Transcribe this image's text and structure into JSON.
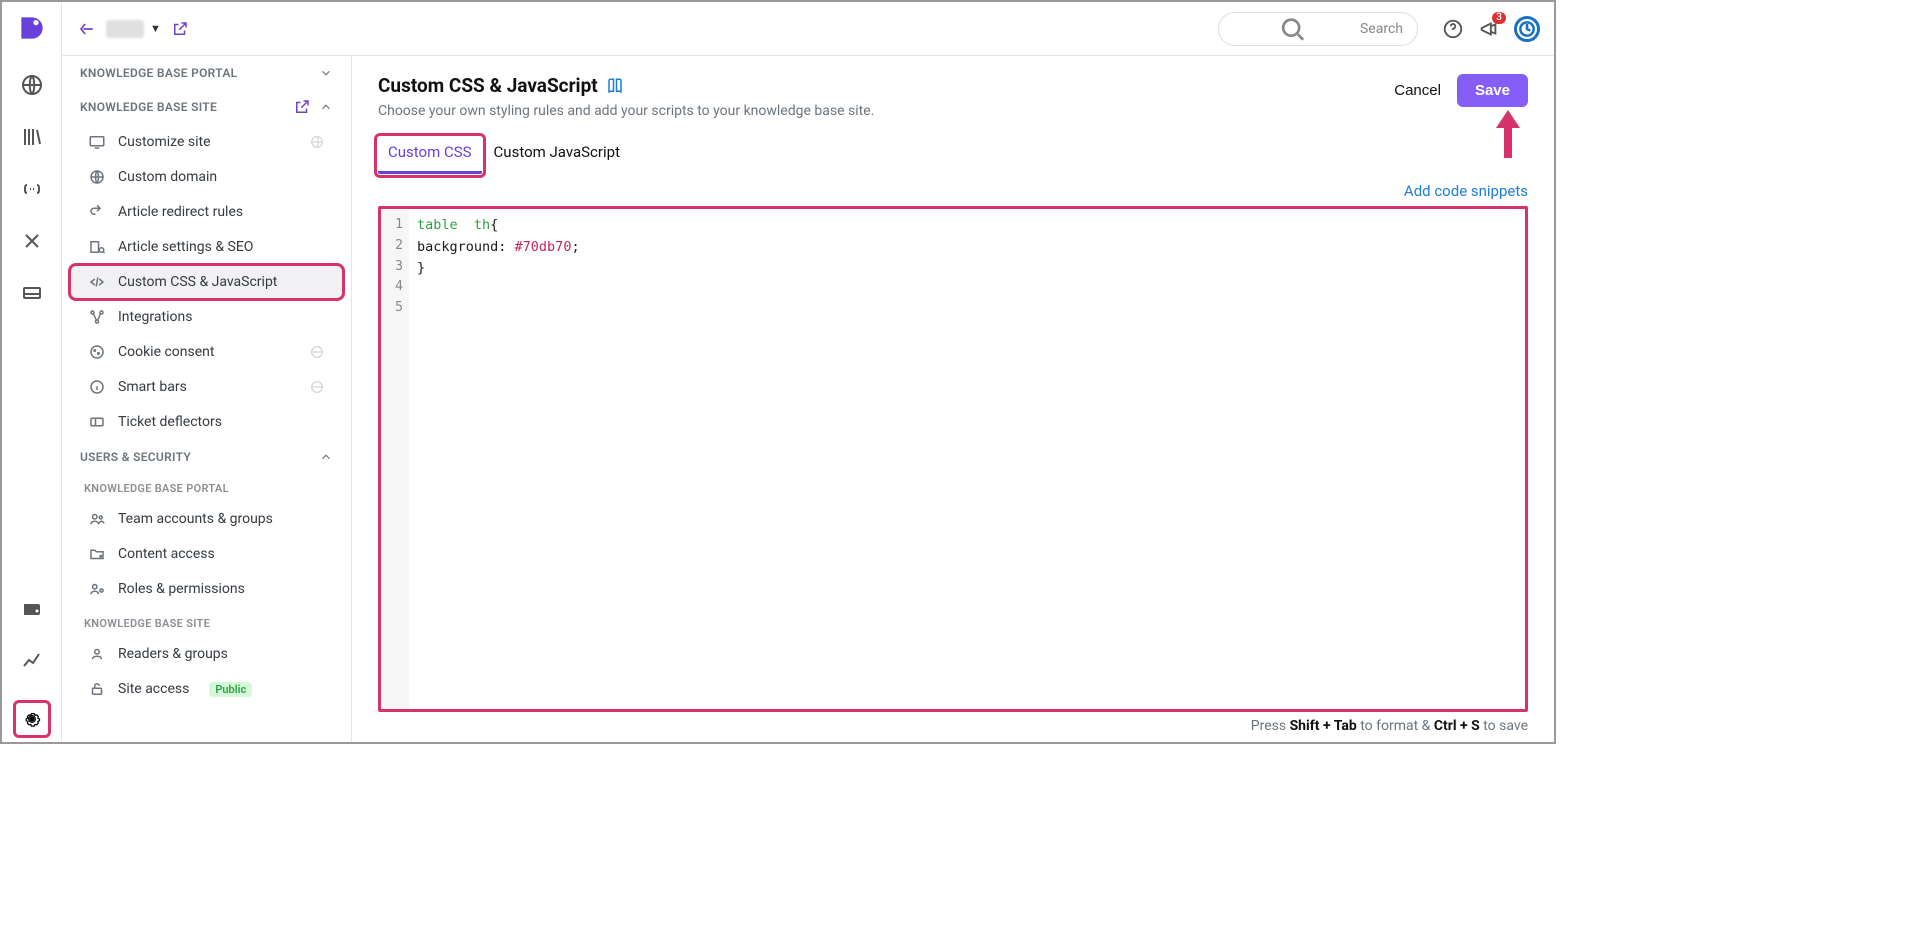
{
  "topbar": {
    "search_placeholder": "Search",
    "notification_count": "3"
  },
  "sidebar": {
    "group_portal": "KNOWLEDGE BASE PORTAL",
    "group_site": "KNOWLEDGE BASE SITE",
    "group_users": "USERS & SECURITY",
    "sub_portal": "KNOWLEDGE BASE PORTAL",
    "sub_site": "KNOWLEDGE BASE SITE",
    "items": {
      "customize_site": "Customize site",
      "custom_domain": "Custom domain",
      "article_redirect": "Article redirect rules",
      "article_settings": "Article settings & SEO",
      "custom_css_js": "Custom CSS & JavaScript",
      "integrations": "Integrations",
      "cookie_consent": "Cookie consent",
      "smart_bars": "Smart bars",
      "ticket_deflectors": "Ticket deflectors",
      "team_accounts": "Team accounts & groups",
      "content_access": "Content access",
      "roles_permissions": "Roles & permissions",
      "readers_groups": "Readers & groups",
      "site_access": "Site access",
      "site_access_badge": "Public"
    }
  },
  "page": {
    "title": "Custom CSS & JavaScript",
    "subtitle": "Choose your own styling rules and add your scripts to your knowledge base site.",
    "cancel": "Cancel",
    "save": "Save",
    "tab_css": "Custom CSS",
    "tab_js": "Custom JavaScript",
    "add_snippets": "Add code snippets",
    "hint_prefix": "Press ",
    "hint_k1": "Shift + Tab",
    "hint_mid": " to format & ",
    "hint_k2": "Ctrl + S",
    "hint_suffix": " to save"
  },
  "editor": {
    "line_numbers": [
      "1",
      "2",
      "3",
      "4",
      "5"
    ],
    "code": {
      "l1_sel": "table  th",
      "l1_brace": "{",
      "l2_prop": "background: ",
      "l2_val": "#70db70",
      "l2_semi": ";",
      "l3": "}"
    }
  }
}
